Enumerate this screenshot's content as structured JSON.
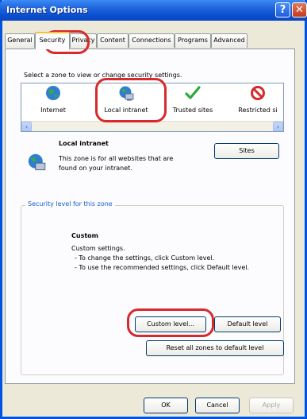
{
  "window": {
    "title": "Internet Options"
  },
  "tabs": [
    {
      "label": "General"
    },
    {
      "label": "Security"
    },
    {
      "label": "Privacy"
    },
    {
      "label": "Content"
    },
    {
      "label": "Connections"
    },
    {
      "label": "Programs"
    },
    {
      "label": "Advanced"
    }
  ],
  "security": {
    "zone_prompt": "Select a zone to view or change security settings.",
    "zones": [
      {
        "label": "Internet",
        "icon": "globe-icon"
      },
      {
        "label": "Local intranet",
        "icon": "intranet-computer-icon"
      },
      {
        "label": "Trusted sites",
        "icon": "green-check-icon"
      },
      {
        "label": "Restricted si",
        "icon": "no-entry-icon"
      }
    ],
    "selected_zone": {
      "name": "Local intranet",
      "description_line1": "This zone is for all websites that are",
      "description_line2": "found on your intranet.",
      "sites_button": "Sites"
    },
    "level_group": {
      "label": "Security level for this zone",
      "level_name": "Custom",
      "line1": "Custom settings.",
      "line2": "- To change the settings, click Custom level.",
      "line3": "- To use the recommended settings, click Default level."
    },
    "buttons": {
      "custom_level": "Custom level...",
      "default_level": "Default level",
      "reset_all": "Reset all zones to default level"
    }
  },
  "footer": {
    "ok": "OK",
    "cancel": "Cancel",
    "apply": "Apply"
  },
  "colors": {
    "title_blue": "#0a4fd1",
    "highlight_ring": "#d8292c",
    "group_label": "#1c5ec9"
  }
}
